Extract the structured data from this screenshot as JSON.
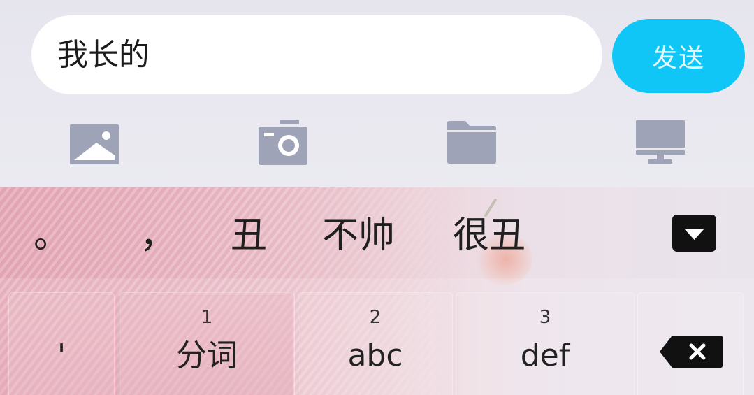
{
  "chat_input": {
    "text": "我长的",
    "send_label": "发送"
  },
  "toolbar": {
    "items": [
      {
        "icon": "image-icon"
      },
      {
        "icon": "camera-icon"
      },
      {
        "icon": "folder-icon"
      },
      {
        "icon": "computer-icon"
      }
    ]
  },
  "candidates": [
    "。",
    "，",
    "丑",
    "不帅",
    "很丑"
  ],
  "keyboard": {
    "keys": [
      {
        "label": "'"
      },
      {
        "number": "1",
        "label": "分词"
      },
      {
        "number": "2",
        "label": "abc"
      },
      {
        "number": "3",
        "label": "def"
      }
    ],
    "collapse_icon": "triangle-down-icon",
    "delete_icon": "backspace-icon"
  },
  "colors": {
    "accent": "#10c6f7",
    "icon": "#9ea3b7",
    "background": "#e8e7ef",
    "keyboard_tint": "#e9b4c1"
  }
}
